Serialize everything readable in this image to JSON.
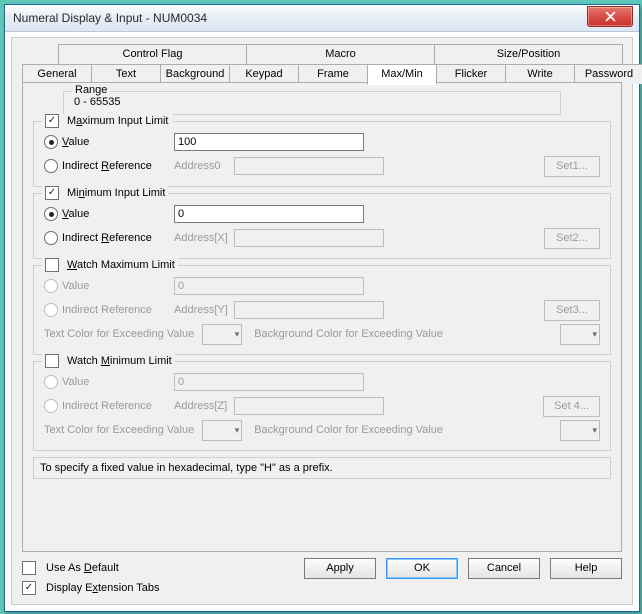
{
  "window": {
    "title": "Numeral Display & Input - NUM0034"
  },
  "tabs": {
    "row_top": [
      "Control Flag",
      "Macro",
      "Size/Position"
    ],
    "row_bottom": [
      "General",
      "Text",
      "Background",
      "Keypad",
      "Frame",
      "Max/Min",
      "Flicker",
      "Write",
      "Password"
    ],
    "active": "Max/Min"
  },
  "range": {
    "label": "Range",
    "text": "0 - 65535"
  },
  "max": {
    "legend": "Maximum Input Limit",
    "checked": true,
    "value_label": "Value",
    "value": "100",
    "indirect_label": "Indirect Reference",
    "address_label": "Address0",
    "address_value": "",
    "set_label": "Set1..."
  },
  "min": {
    "legend": "Minimum Input Limit",
    "checked": true,
    "value_label": "Value",
    "value": "0",
    "indirect_label": "Indirect Reference",
    "address_label": "Address[X]",
    "address_value": "",
    "set_label": "Set2..."
  },
  "wmax": {
    "legend": "Watch Maximum Limit",
    "checked": false,
    "value_label": "Value",
    "value": "0",
    "indirect_label": "Indirect Reference",
    "address_label": "Address[Y]",
    "address_value": "",
    "set_label": "Set3...",
    "textcolor_label": "Text Color for Exceeding Value",
    "bgcolor_label": "Background Color for Exceeding Value"
  },
  "wmin": {
    "legend": "Watch Minimum Limit",
    "checked": false,
    "value_label": "Value",
    "value": "0",
    "indirect_label": "Indirect Reference",
    "address_label": "Address[Z]",
    "address_value": "",
    "set_label": "Set 4...",
    "textcolor_label": "Text Color for Exceeding Value",
    "bgcolor_label": "Background Color for Exceeding Value"
  },
  "hint": "To specify a fixed value in hexadecimal, type \"H\" as a prefix.",
  "footer": {
    "use_default": {
      "label": "Use As Default",
      "checked": false
    },
    "ext_tabs": {
      "label": "Display Extension Tabs",
      "checked": true
    },
    "apply": "Apply",
    "ok": "OK",
    "cancel": "Cancel",
    "help": "Help"
  }
}
